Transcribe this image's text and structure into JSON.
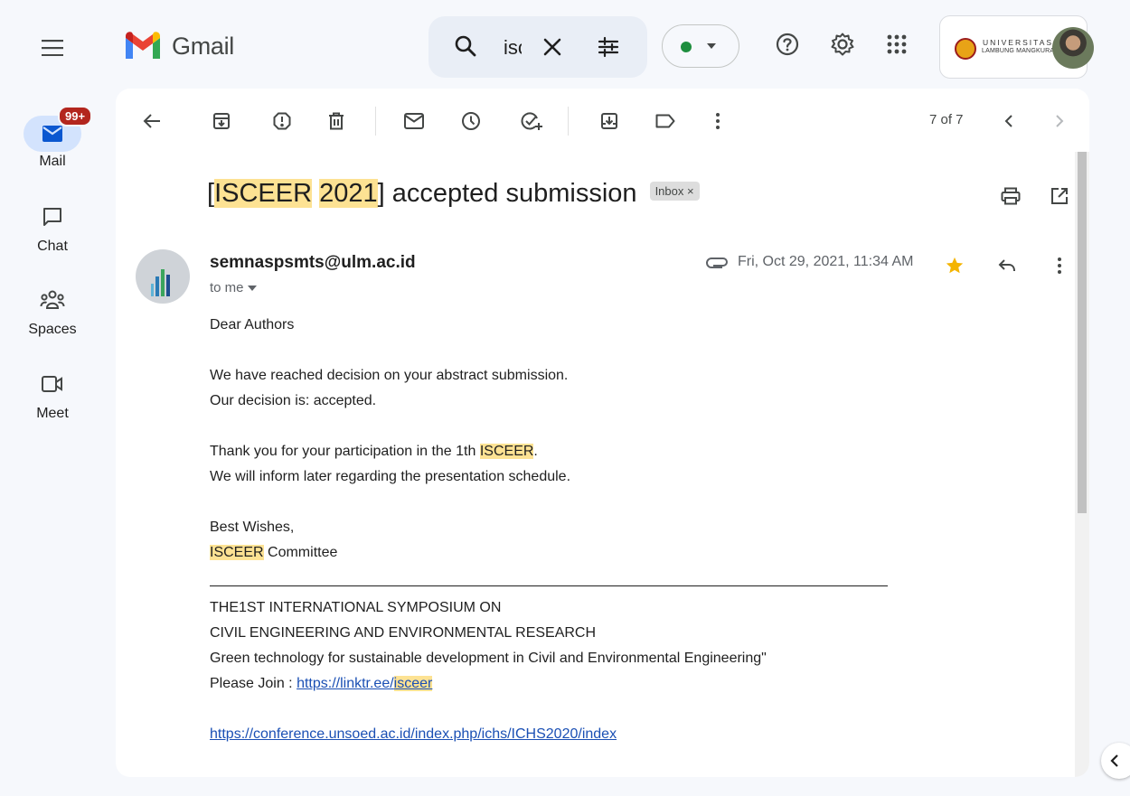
{
  "app": {
    "name": "Gmail",
    "search_value": "isceer",
    "status_dot_color": "#1e8e3e",
    "account": {
      "org_line1": "UNIVERSITAS",
      "org_line2": "LAMBUNG MANGKURAT"
    }
  },
  "rail": {
    "items": [
      {
        "label": "Mail",
        "icon": "mail-icon",
        "badge": "99+"
      },
      {
        "label": "Chat",
        "icon": "chat-icon"
      },
      {
        "label": "Spaces",
        "icon": "spaces-icon"
      },
      {
        "label": "Meet",
        "icon": "video-icon"
      }
    ]
  },
  "toolbar": {
    "pager": "7 of 7"
  },
  "email": {
    "subject_parts": [
      "[",
      "ISCEER",
      " ",
      "2021",
      "] accepted submission"
    ],
    "label_chip": "Inbox",
    "label_chip_close": "×",
    "sender": "semnaspsmts@ulm.ac.id",
    "recipient": "to me",
    "date": "Fri, Oct 29, 2021, 11:34 AM",
    "starred": true,
    "body": {
      "greeting": "Dear Authors",
      "line1": "We have reached decision on your abstract submission.",
      "line2": "Our decision is: accepted.",
      "line3_prefix": "Thank you for your participation in the 1th ",
      "line3_hl": "ISCEER",
      "line3_suffix": ".",
      "line4": "We will inform later regarding the presentation schedule.",
      "closing": "Best Wishes,",
      "committee_hl": "ISCEER",
      "committee_suffix": " Committee",
      "sig1": "THE1ST INTERNATIONAL SYMPOSIUM ON",
      "sig2": "CIVIL ENGINEERING AND ENVIRONMENTAL RESEARCH",
      "sig3": "Green technology for sustainable development in Civil and Environmental Engineering\"",
      "join_prefix": "Please Join : ",
      "join_link_a": "https://linktr.ee/",
      "join_link_hl": "isceer",
      "link2": "https://conference.unsoed.ac.id/index.php/ichs/ICHS2020/index"
    }
  },
  "colors": {
    "highlight": "#fde293",
    "star": "#f4b400",
    "link": "#1a4fb4"
  }
}
